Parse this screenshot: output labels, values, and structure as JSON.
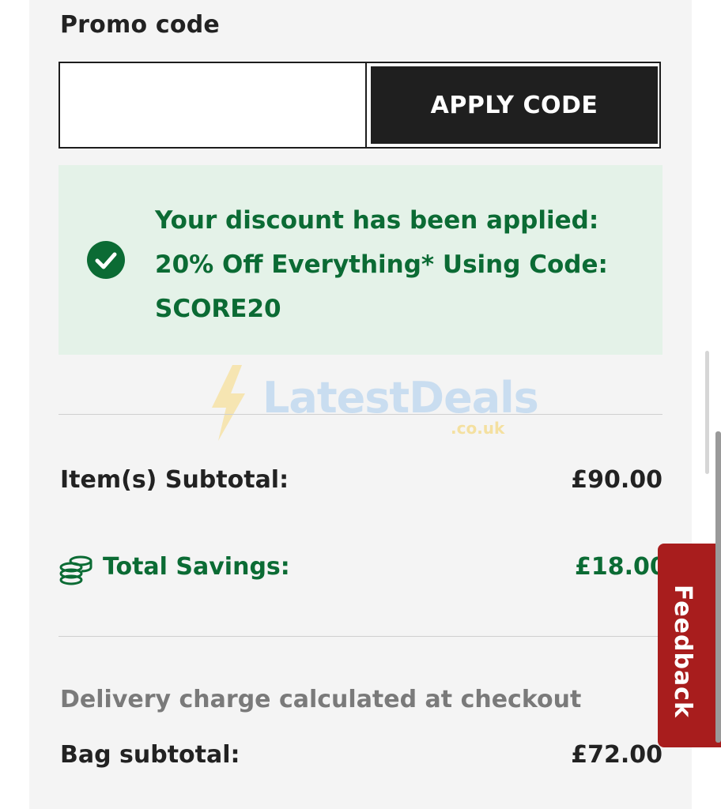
{
  "promo": {
    "label": "Promo code",
    "input_value": "",
    "input_placeholder": "",
    "apply_label": "APPLY CODE"
  },
  "discount": {
    "message": "Your discount has been applied: 20% Off Everything* Using Code: SCORE20",
    "icon": "check-circle-icon",
    "color": "#0b6b34",
    "background": "#e4f2e8"
  },
  "watermark": {
    "text": "LatestDeals",
    "subtext": ".co.uk"
  },
  "summary": {
    "items_subtotal_label": "Item(s) Subtotal:",
    "items_subtotal_value": "£90.00",
    "savings_label": "Total Savings:",
    "savings_value": "£18.00",
    "savings_icon": "coins-icon",
    "delivery_note": "Delivery charge calculated at checkout",
    "bag_subtotal_label": "Bag subtotal:",
    "bag_subtotal_value": "£72.00"
  },
  "feedback": {
    "label": "Feedback",
    "color": "#a81d1d"
  }
}
